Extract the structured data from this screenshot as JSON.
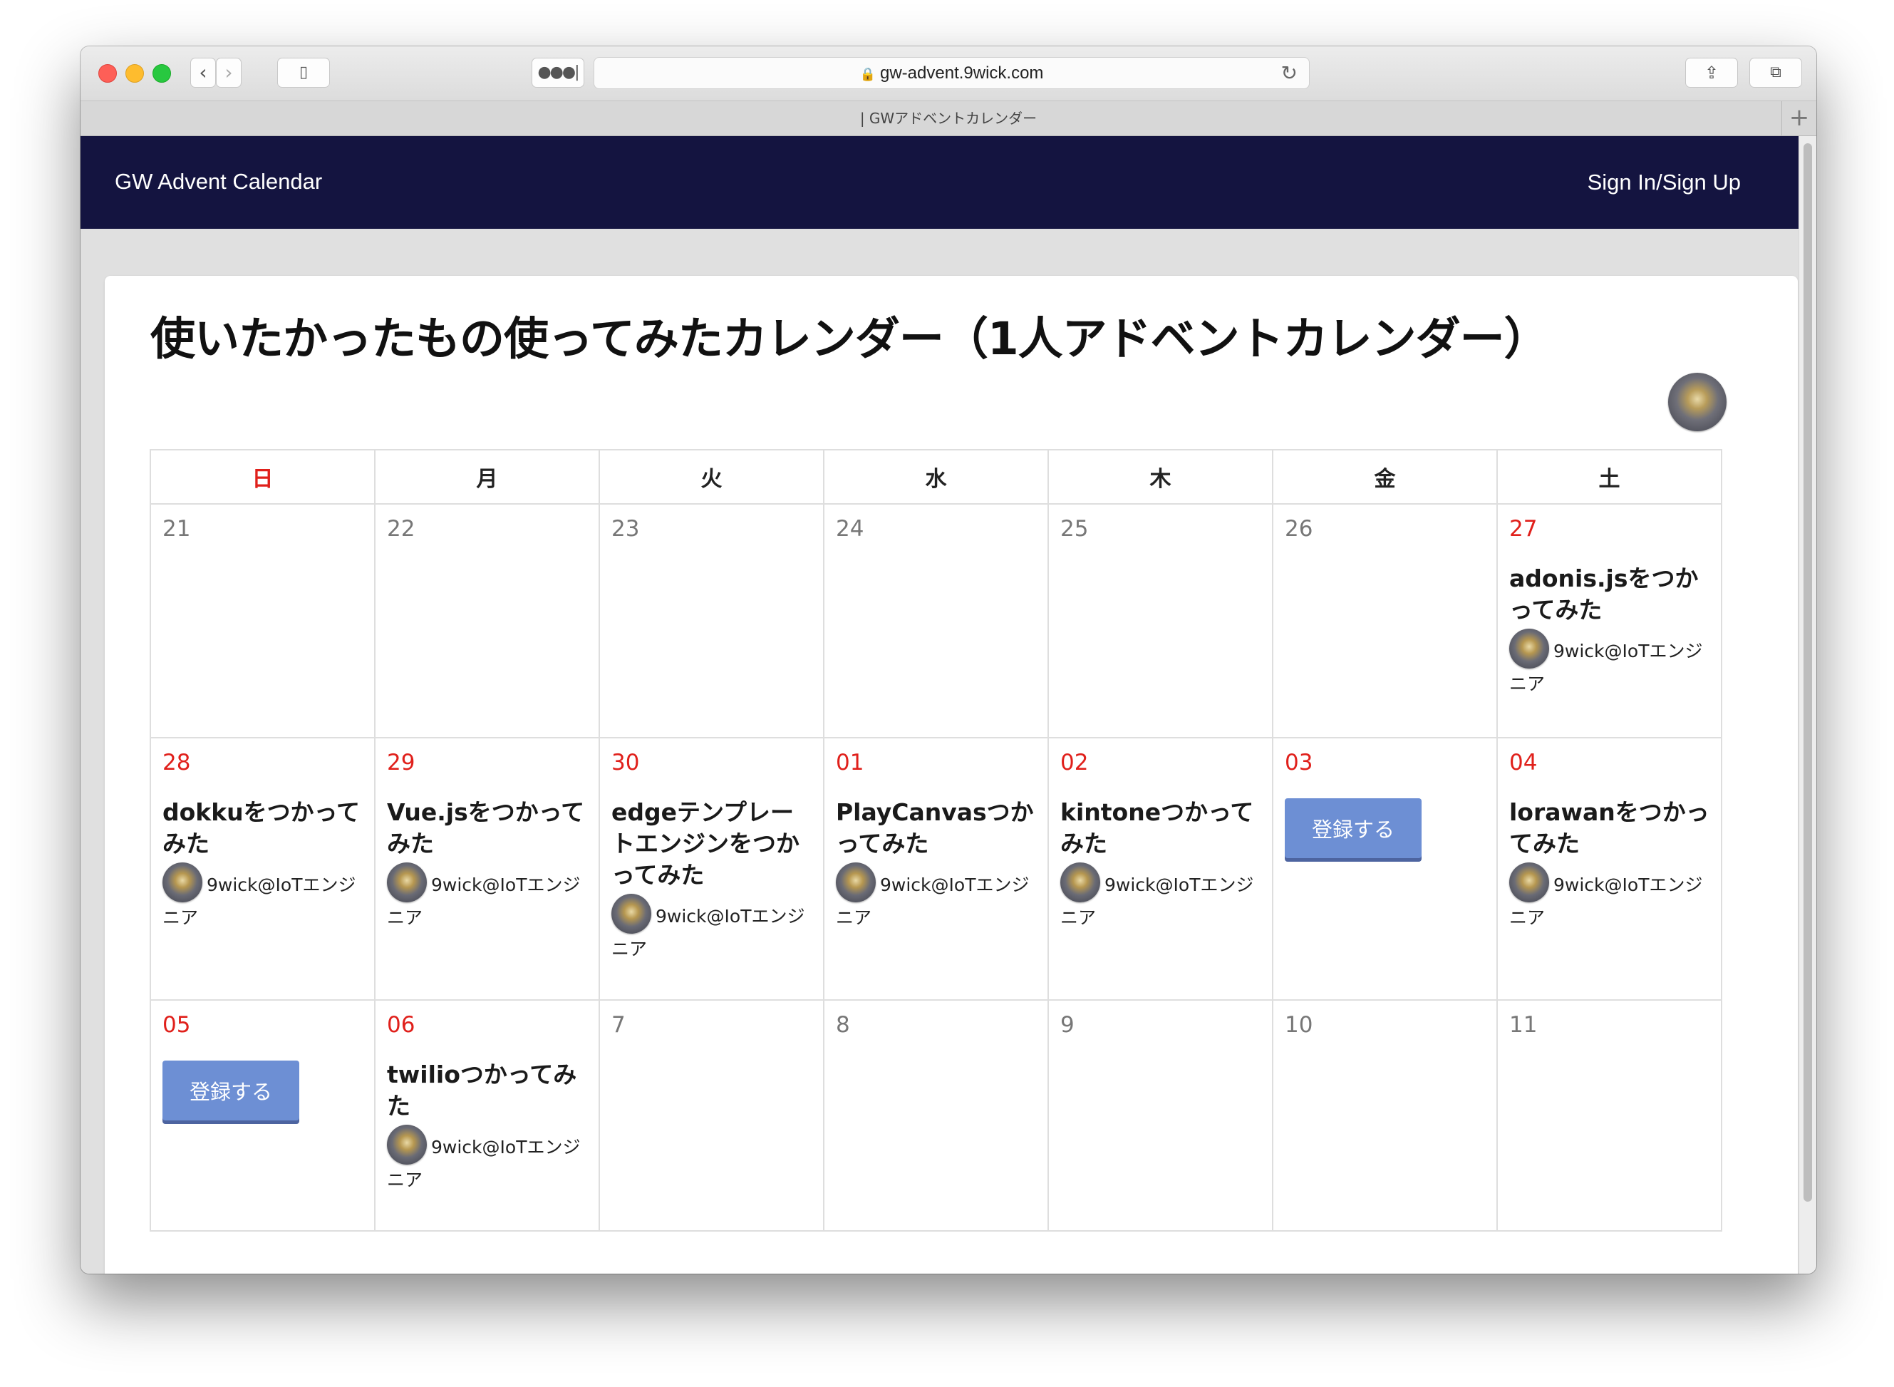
{
  "browser": {
    "url": "gw-advent.9wick.com",
    "tab_title": "| GWアドベントカレンダー"
  },
  "navbar": {
    "brand": "GW Advent Calendar",
    "signin": "Sign In/Sign Up"
  },
  "page": {
    "title": "使いたかったもの使ってみたカレンダー（1人アドベントカレンダー）"
  },
  "calendar": {
    "weekdays": [
      "日",
      "月",
      "火",
      "水",
      "木",
      "金",
      "土"
    ],
    "register_label": "登録する",
    "weeks": [
      [
        {
          "day": "21"
        },
        {
          "day": "22"
        },
        {
          "day": "23"
        },
        {
          "day": "24"
        },
        {
          "day": "25"
        },
        {
          "day": "26"
        },
        {
          "day": "27",
          "title": "adonis.jsをつかってみた",
          "author": "9wick@IoTエンジニア"
        }
      ],
      [
        {
          "day": "28",
          "title": "dokkuをつかってみた",
          "author": "9wick@IoTエンジニア"
        },
        {
          "day": "29",
          "title": "Vue.jsをつかってみた",
          "author": "9wick@IoTエンジニア"
        },
        {
          "day": "30",
          "title": "edgeテンプレートエンジンをつかってみた",
          "author": "9wick@IoTエンジニア"
        },
        {
          "day": "01",
          "title": "PlayCanvasつかってみた",
          "author": "9wick@IoTエンジニア"
        },
        {
          "day": "02",
          "title": "kintoneつかってみた",
          "author": "9wick@IoTエンジニア"
        },
        {
          "day": "03"
        },
        {
          "day": "04",
          "title": "lorawanをつかってみた",
          "author": "9wick@IoTエンジニア"
        }
      ],
      [
        {
          "day": "05"
        },
        {
          "day": "06",
          "title": "twilioつかってみた",
          "author": "9wick@IoTエンジニア"
        },
        {
          "day": "7"
        },
        {
          "day": "8"
        },
        {
          "day": "9"
        },
        {
          "day": "10"
        },
        {
          "day": "11"
        }
      ]
    ]
  }
}
